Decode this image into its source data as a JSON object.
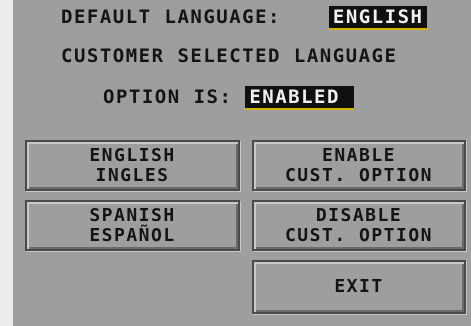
{
  "header": {
    "default_language_label": "DEFAULT LANGUAGE:",
    "default_language_value": "ENGLISH",
    "customer_selected_label": "CUSTOMER SELECTED LANGUAGE",
    "option_is_label": "OPTION IS:",
    "option_is_value": "ENABLED"
  },
  "buttons": {
    "english": {
      "line1": "ENGLISH",
      "line2": "INGLES"
    },
    "spanish": {
      "line1": "SPANISH",
      "line2": "ESPAÑOL"
    },
    "enable": {
      "line1": "ENABLE",
      "line2": "CUST. OPTION"
    },
    "disable": {
      "line1": "DISABLE",
      "line2": "CUST. OPTION"
    },
    "exit": {
      "line1": "EXIT"
    }
  },
  "colors": {
    "screen_background": "#9e9e9e",
    "text": "#141414",
    "highlight_background": "#101010",
    "highlight_text": "#f0f0f0",
    "highlight_underline": "#d8b400"
  }
}
